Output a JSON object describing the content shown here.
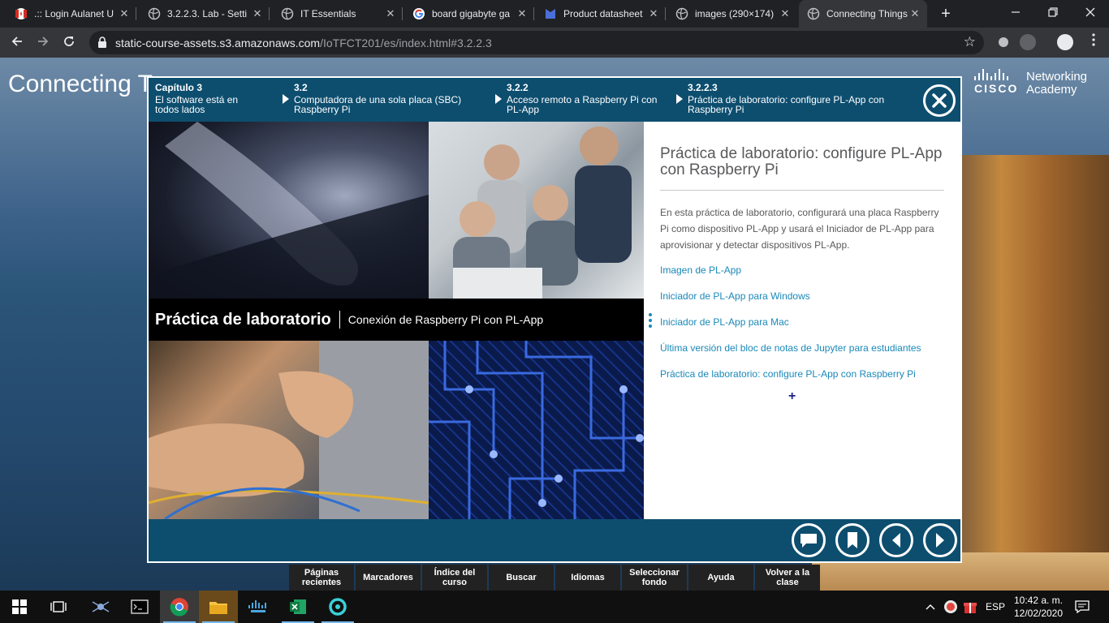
{
  "browser": {
    "tabs": [
      {
        "title": ".:: Login Aulanet U",
        "icon": "flag-icon"
      },
      {
        "title": "3.2.2.3. Lab - Setti",
        "icon": "globe-icon"
      },
      {
        "title": "IT Essentials",
        "icon": "globe-icon"
      },
      {
        "title": "board gigabyte ga",
        "icon": "google-icon"
      },
      {
        "title": "Product datasheet",
        "icon": "document-icon"
      },
      {
        "title": "images (290×174)",
        "icon": "globe-icon"
      },
      {
        "title": "Connecting Things",
        "icon": "globe-icon",
        "active": true
      }
    ],
    "close_glyph": "✕",
    "new_tab_glyph": "+",
    "url_host": "static-course-assets.s3.amazonaws.com",
    "url_path": "/IoTFCT201/es/index.html#3.2.2.3"
  },
  "page": {
    "title": "Connecting T",
    "logo": {
      "word": "CISCO",
      "line1": "Networking",
      "line2": "Academy"
    }
  },
  "breadcrumb": [
    {
      "num": "Capítulo 3",
      "text": "El software está en todos lados"
    },
    {
      "num": "3.2",
      "text": "Computadora de una sola placa (SBC) Raspberry Pi"
    },
    {
      "num": "3.2.2",
      "text": "Acceso remoto a Raspberry Pi con PL-App"
    },
    {
      "num": "3.2.2.3",
      "text": "Práctica de laboratorio: configure PL-App con Raspberry Pi"
    }
  ],
  "lab_banner": {
    "title": "Práctica de laboratorio",
    "subtitle": "Conexión de Raspberry Pi con PL-App"
  },
  "content": {
    "heading": "Práctica de laboratorio: configure PL-App con Raspberry Pi",
    "description": "En esta práctica de laboratorio, configurará una placa Raspberry Pi como dispositivo PL-App y usará el Iniciador de PL-App para aprovisionar y detectar dispositivos PL-App.",
    "links": [
      "Imagen de PL-App",
      "Iniciador de PL-App para Windows",
      "Iniciador de PL-App para Mac",
      "Última versión del bloc de notas de Jupyter para estudiantes",
      "Práctica de laboratorio: configure PL-App con Raspberry Pi"
    ],
    "plus_glyph": "+"
  },
  "footer_buttons": [
    "comment-icon",
    "bookmark-icon",
    "prev-icon",
    "next-icon"
  ],
  "bottom_nav": [
    "Páginas recientes",
    "Marcadores",
    "Índice del curso",
    "Buscar",
    "Idiomas",
    "Seleccionar fondo",
    "Ayuda",
    "Volver a la clase"
  ],
  "taskbar": {
    "language": "ESP",
    "time": "10:42 a. m.",
    "date": "12/02/2020"
  },
  "colors": {
    "header_blue": "#0d4e6f",
    "link_blue": "#1a88b8",
    "heading_gray": "#58595b"
  }
}
